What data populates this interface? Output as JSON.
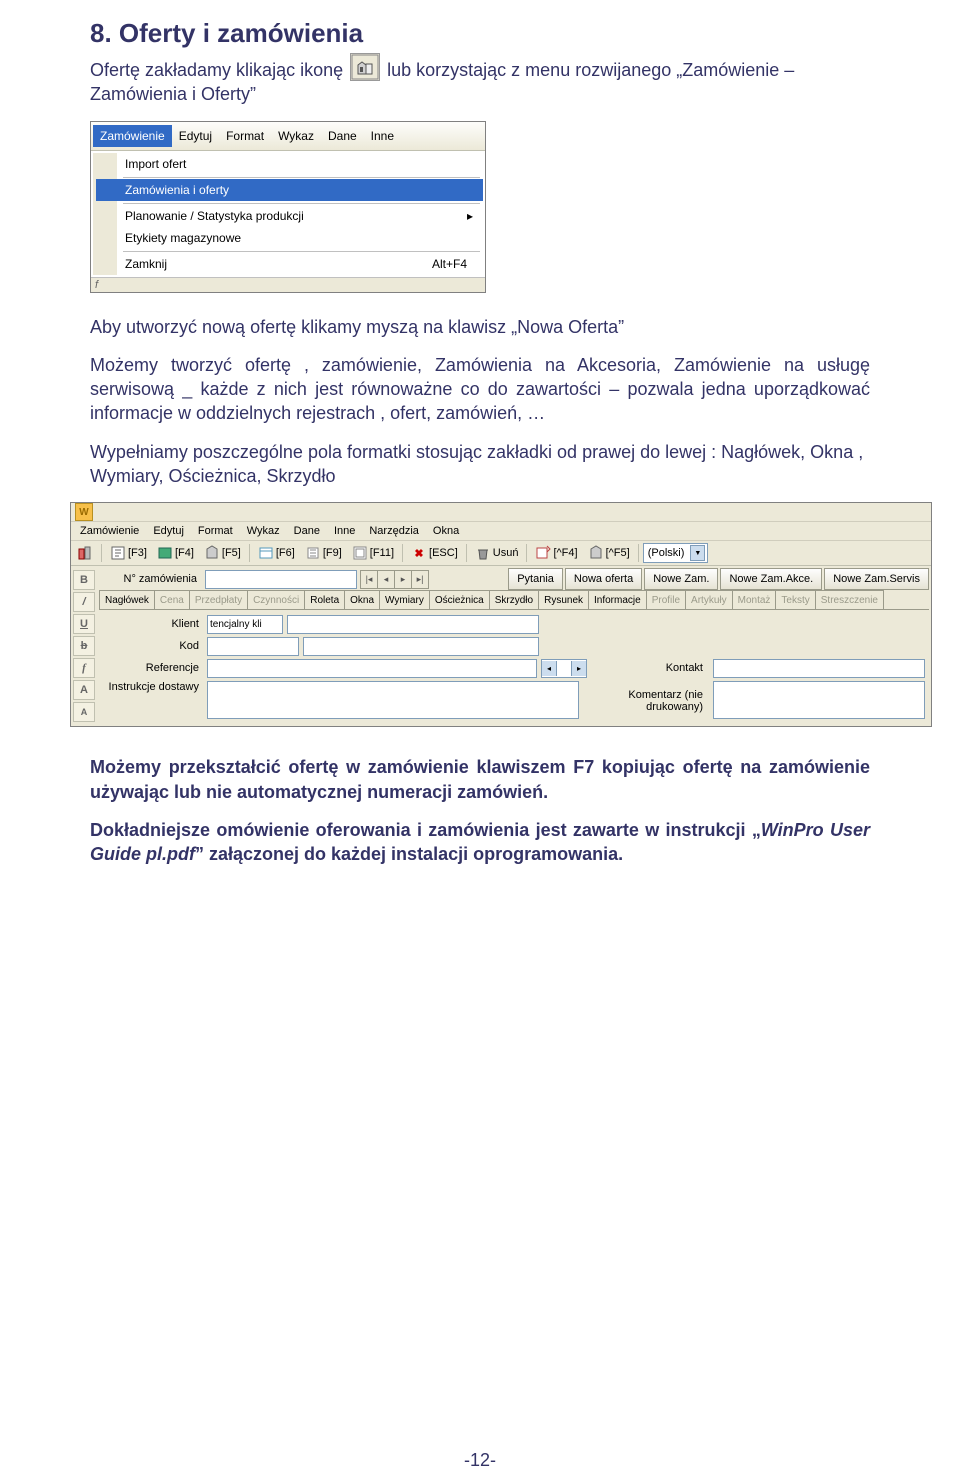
{
  "section_title": "8. Oferty i zamówienia",
  "intro": {
    "p1a": "Ofertę zakładamy klikając ikonę ",
    "p1b": " lub korzystając z menu rozwijanego „Zamówienie – Zamówienia i Oferty”"
  },
  "menu": {
    "items": [
      "Zamówienie",
      "Edytuj",
      "Format",
      "Wykaz",
      "Dane",
      "Inne"
    ],
    "dropdown": {
      "import": "Import ofert",
      "zam_oferty": "Zamówienia i oferty",
      "planowanie": "Planowanie / Statystyka produkcji",
      "etykiety": "Etykiety magazynowe",
      "zamknij": "Zamknij",
      "zamknij_shortcut": "Alt+F4"
    },
    "statusbar_hint": "f"
  },
  "para2": "Aby utworzyć nową ofertę klikamy myszą na klawisz „Nowa Oferta”",
  "para3": "Możemy tworzyć ofertę , zamówienie, Zamówienia na Akcesoria, Zamówienie na usługę serwisową _ każde z nich jest równoważne co do zawartości – pozwala jedna uporządkować informacje w oddzielnych rejestrach , ofert, zamówień, …",
  "para4": "Wypełniamy poszczególne pola formatki stosując zakładki od prawej do lewej : Nagłówek, Okna , Wymiary, Ościeżnica, Skrzydło",
  "app": {
    "title_logo": "W",
    "menu": [
      "Zamówienie",
      "Edytuj",
      "Format",
      "Wykaz",
      "Dane",
      "Inne",
      "Narzędzia",
      "Okna"
    ],
    "toolbar": {
      "f3": "[F3]",
      "f4": "[F4]",
      "f5": "[F5]",
      "f6": "[F6]",
      "f9": "[F9]",
      "f11": "[F11]",
      "esc": "[ESC]",
      "usun": "Usuń",
      "ctrl_f4": "[^F4]",
      "ctrl_f5": "[^F5]",
      "lang": "(Polski)"
    },
    "left_rail": [
      "B",
      "/",
      "U",
      "b",
      "f",
      "A",
      "A"
    ],
    "order_label": "N° zamówienia",
    "top_buttons": [
      "Pytania",
      "Nowa oferta",
      "Nowe Zam.",
      "Nowe Zam.Akce.",
      "Nowe Zam.Servis"
    ],
    "tabs": [
      "Nagłówek",
      "Cena",
      "Przedpłaty",
      "Czynności",
      "Roleta",
      "Okna",
      "Wymiary",
      "Ościeżnica",
      "Skrzydło",
      "Rysunek",
      "Informacje",
      "Profile",
      "Artykuły",
      "Montaż",
      "Teksty",
      "Streszczenie"
    ],
    "dim_tabs": [
      "Cena",
      "Przedpłaty",
      "Czynności",
      "Profile",
      "Artykuły",
      "Montaż",
      "Teksty",
      "Streszczenie"
    ],
    "fields": {
      "klient": "Klient",
      "klient_hint": "tencjalny kli",
      "kod": "Kod",
      "referencje": "Referencje",
      "instrukcje": "Instrukcje dostawy",
      "kontakt": "Kontakt",
      "komentarz": "Komentarz (nie drukowany)"
    }
  },
  "para5": "Możemy przekształcić ofertę w zamówienie klawiszem F7 kopiując ofertę na zamówienie używając lub nie automatycznej numeracji zamówień.",
  "para6_a": "Dokładniejsze omówienie oferowania i zamówienia jest zawarte w instrukcji „",
  "para6_file": "WinPro User Guide pl.pdf",
  "para6_b": "” załączonej do każdej instalacji oprogramowania.",
  "page_number": "-12-"
}
